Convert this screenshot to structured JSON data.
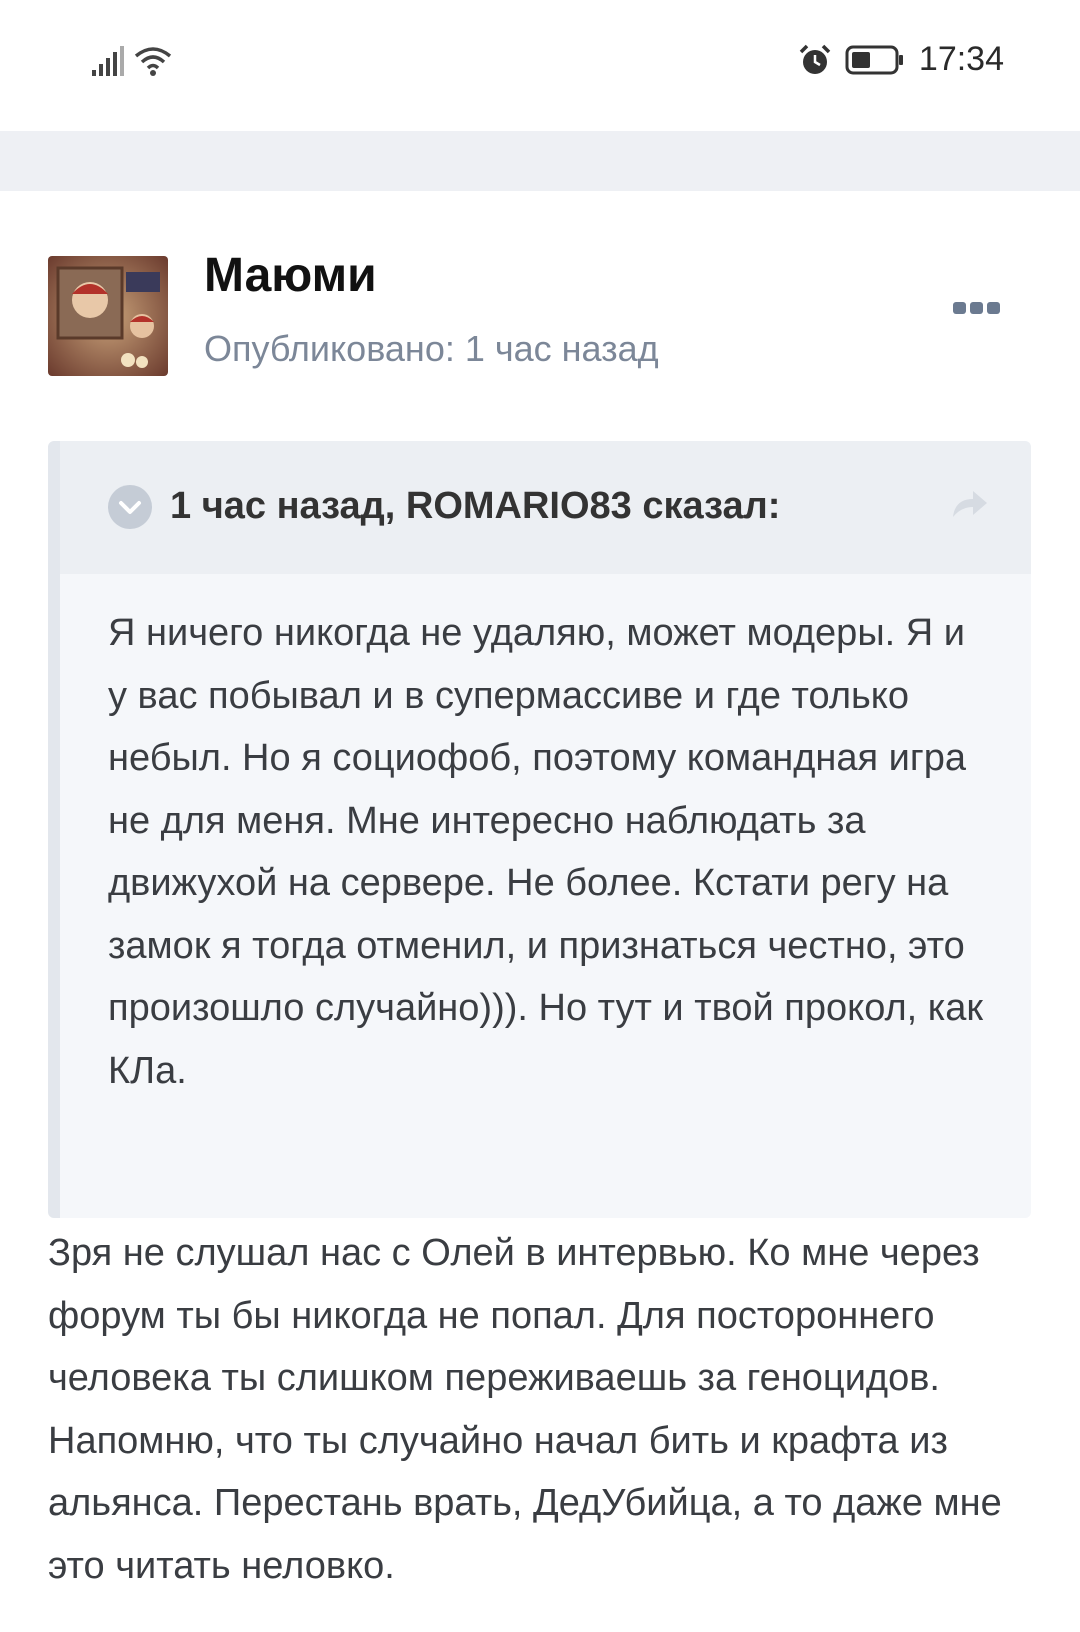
{
  "status_bar": {
    "time": "17:34",
    "icons": [
      "signal-icon",
      "wifi-icon",
      "alarm-icon",
      "battery-icon"
    ]
  },
  "post": {
    "author": "Маюми",
    "published": "Опубликовано: 1 час назад",
    "more_icon": "ellipsis-icon",
    "quote": {
      "citation": "1 час назад, ROMARIO83 сказал:",
      "paragraph": "Я ничего никогда не удаляю, может модеры. Я и у вас побывал и в супермассиве и где только небыл. Но я социофоб, поэтому командная игра не для меня. Мне интересно наблюдать за движухой на сервере. Не более. Кстати регу на замок я тогда отменил, и признаться честно, это произошло случайно))). Но тут и твой прокол, как КЛа."
    },
    "reply": "Зря не слушал нас с Олей в интервью. Ко мне через форум ты бы никогда не попал. Для постороннего человека ты слишком переживаешь за геноцидов. Напомню, что ты случайно начал бить и крафта из альянса. Перестань врать, ДедУбийца, а то даже мне это читать неловко."
  },
  "colors": {
    "background": "#ffffff",
    "band": "#eef0f4",
    "quote_bg": "#f5f7fa",
    "quote_head_bg": "#eceff3",
    "meta_text": "#7c8798",
    "body_text": "#3a3d42"
  }
}
